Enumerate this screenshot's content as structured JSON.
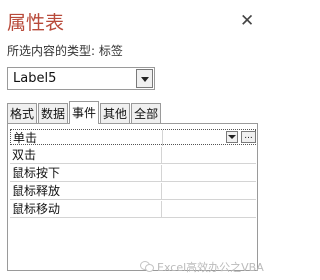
{
  "panel": {
    "title": "属性表",
    "selection_type_label": "所选内容的类型:  标签"
  },
  "object_selector": {
    "value": "Label5"
  },
  "tabs": [
    {
      "label": "格式",
      "active": false
    },
    {
      "label": "数据",
      "active": false
    },
    {
      "label": "事件",
      "active": true
    },
    {
      "label": "其他",
      "active": false
    },
    {
      "label": "全部",
      "active": false
    }
  ],
  "properties": [
    {
      "name": "单击",
      "value": ""
    },
    {
      "name": "双击",
      "value": ""
    },
    {
      "name": "鼠标按下",
      "value": ""
    },
    {
      "name": "鼠标释放",
      "value": ""
    },
    {
      "name": "鼠标移动",
      "value": ""
    }
  ],
  "builder_button_label": "...",
  "watermark": "Excel高效办公之VBA",
  "icons": {
    "close": "close-icon",
    "dropdown": "chevron-down-icon",
    "builder": "ellipsis-icon",
    "watermark": "wechat-icon"
  }
}
